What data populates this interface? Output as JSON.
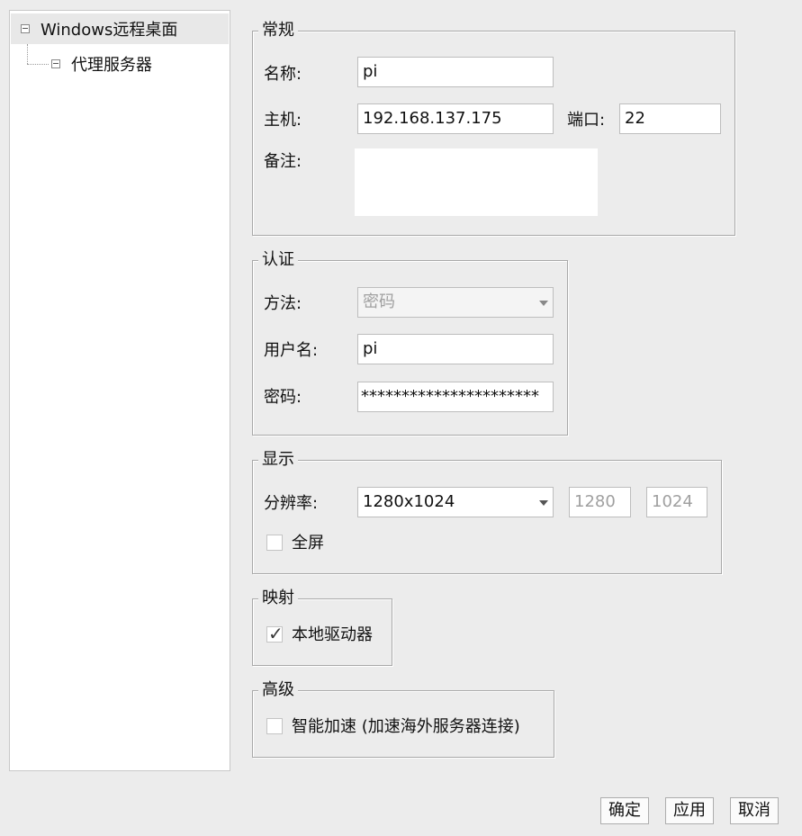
{
  "tree": {
    "root_label": "Windows远程桌面",
    "child_label": "代理服务器"
  },
  "general": {
    "legend": "常规",
    "name_label": "名称:",
    "name_value": "pi",
    "host_label": "主机:",
    "host_value": "192.168.137.175",
    "port_label": "端口:",
    "port_value": "22",
    "note_label": "备注:",
    "note_value": ""
  },
  "auth": {
    "legend": "认证",
    "method_label": "方法:",
    "method_value": "密码",
    "user_label": "用户名:",
    "user_value": "pi",
    "password_label": "密码:",
    "password_value": "**********************"
  },
  "display": {
    "legend": "显示",
    "resolution_label": "分辨率:",
    "resolution_value": "1280x1024",
    "width_value": "1280",
    "height_value": "1024",
    "fullscreen_label": "全屏",
    "fullscreen_checked": false
  },
  "mapping": {
    "legend": "映射",
    "local_drive_label": "本地驱动器",
    "local_drive_checked": true
  },
  "advanced": {
    "legend": "高级",
    "accel_label": "智能加速 (加速海外服务器连接)",
    "accel_checked": false
  },
  "buttons": {
    "ok": "确定",
    "apply": "应用",
    "cancel": "取消"
  }
}
